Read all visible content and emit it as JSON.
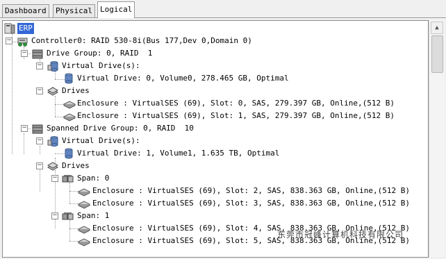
{
  "tabs": [
    {
      "label": "Dashboard",
      "active": false
    },
    {
      "label": "Physical",
      "active": false
    },
    {
      "label": "Logical",
      "active": true
    }
  ],
  "tree": {
    "root": "ERP",
    "controller": "Controller0: RAID 530-8i(Bus 177,Dev 0,Domain 0)",
    "drive_group": "Drive Group: 0, RAID  1",
    "virtual_drives_label": "Virtual Drive(s):",
    "virtual_drive_0": "Virtual Drive: 0, Volume0, 278.465 GB, Optimal",
    "drives_label": "Drives",
    "dg0_drives": [
      "Enclosure : VirtualSES (69), Slot: 0, SAS, 279.397 GB, Online,(512 B)",
      "Enclosure : VirtualSES (69), Slot: 1, SAS, 279.397 GB, Online,(512 B)"
    ],
    "spanned_group": "Spanned Drive Group: 0, RAID  10",
    "virtual_drive_1": "Virtual Drive: 1, Volume1, 1.635 TB, Optimal",
    "span0": "Span: 0",
    "span0_drives": [
      "Enclosure : VirtualSES (69), Slot: 2, SAS, 838.363 GB, Online,(512 B)",
      "Enclosure : VirtualSES (69), Slot: 3, SAS, 838.363 GB, Online,(512 B)"
    ],
    "span1": "Span: 1",
    "span1_drives": [
      "Enclosure : VirtualSES (69), Slot: 4, SAS, 838.363 GB, Online,(512 B)",
      "Enclosure : VirtualSES (69), Slot: 5, SAS, 838.363 GB, Online,(512 B)"
    ]
  },
  "expander_symbol": "−",
  "watermark": "东莞市冠峰计算机科技有限公司",
  "colors": {
    "selection": "#3367d6",
    "tree_background": "#ffffff",
    "window_background": "#f0f0f0"
  },
  "icons": {
    "root": "server-icon",
    "controller": "controller-icon",
    "group": "disk-stack-icon",
    "virtual_drive": "cylinder-icon",
    "drive": "hard-drive-icon",
    "span": "span-icon"
  }
}
